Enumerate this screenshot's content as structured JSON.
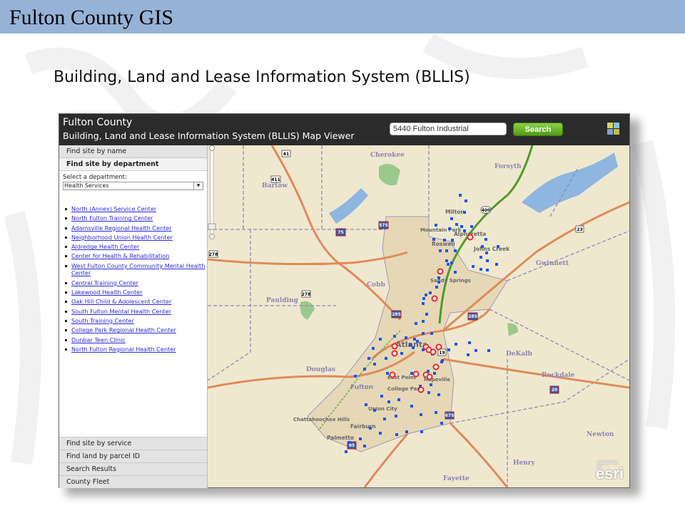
{
  "slide": {
    "title": "Fulton County GIS",
    "subtitle": "Building, Land and Lease Information System (BLLIS)"
  },
  "app": {
    "title_line1": "Fulton County",
    "title_line2": "Building, Land and Lease Information System (BLLIS) Map Viewer",
    "search_value": "5440 Fulton Industrial",
    "search_button": "Search",
    "basemap_icon": "basemap-gallery-icon"
  },
  "sidebar": {
    "panels_top": [
      "Find site by name",
      "Find site by department"
    ],
    "department_label": "Select a department:",
    "department_selected": "Health Services",
    "sites": [
      "North (Annex) Service Center",
      "North Fulton Training Center",
      "Adamsville Regional Health Center",
      "Neighborhood Union Health Center",
      "Aldredge Health Center",
      "Center for Health & Rehabilitation",
      "West Fulton County Community Mental Health Center",
      "Central Training Center",
      "Lakewood Health Center",
      "Oak Hill Child & Adolescent Center",
      "South Fulton Mental Health Center",
      "South Training Center",
      "College Park Regional Health Center",
      "Dunbar Teen Clinic",
      "North Fulton Regional Health Center"
    ],
    "panels_bottom": [
      "Find site by service",
      "Find land by parcel ID",
      "Search Results",
      "County Fleet"
    ]
  },
  "map": {
    "county_labels": [
      "Cherokee",
      "Forsyth",
      "Bartow",
      "Cobb",
      "Gwinnett",
      "Paulding",
      "Douglas",
      "DeKalb",
      "Rockdale",
      "Newton",
      "Henry",
      "Fayette"
    ],
    "city_labels": [
      "Milton",
      "Mountain Park",
      "Roswell",
      "Alpharetta",
      "Johns Creek",
      "Sandy Springs",
      "Atlanta",
      "East Point",
      "Hapeville",
      "College Park",
      "Fulton",
      "Union City",
      "Fairburn",
      "Palmetto",
      "Chattahoochee Hills"
    ],
    "highway_shields": [
      "41",
      "411",
      "575",
      "75",
      "400",
      "23",
      "285",
      "278",
      "20",
      "85",
      "675",
      "19"
    ],
    "attribution": "esri",
    "attribution_small": "POWERED BY",
    "colors": {
      "site_marker": "#e8262b",
      "parcel_marker": "#1a56f0",
      "ga400": "#4e9a2a",
      "interstate": "#e08a5a",
      "water": "#8eb6e0"
    }
  }
}
